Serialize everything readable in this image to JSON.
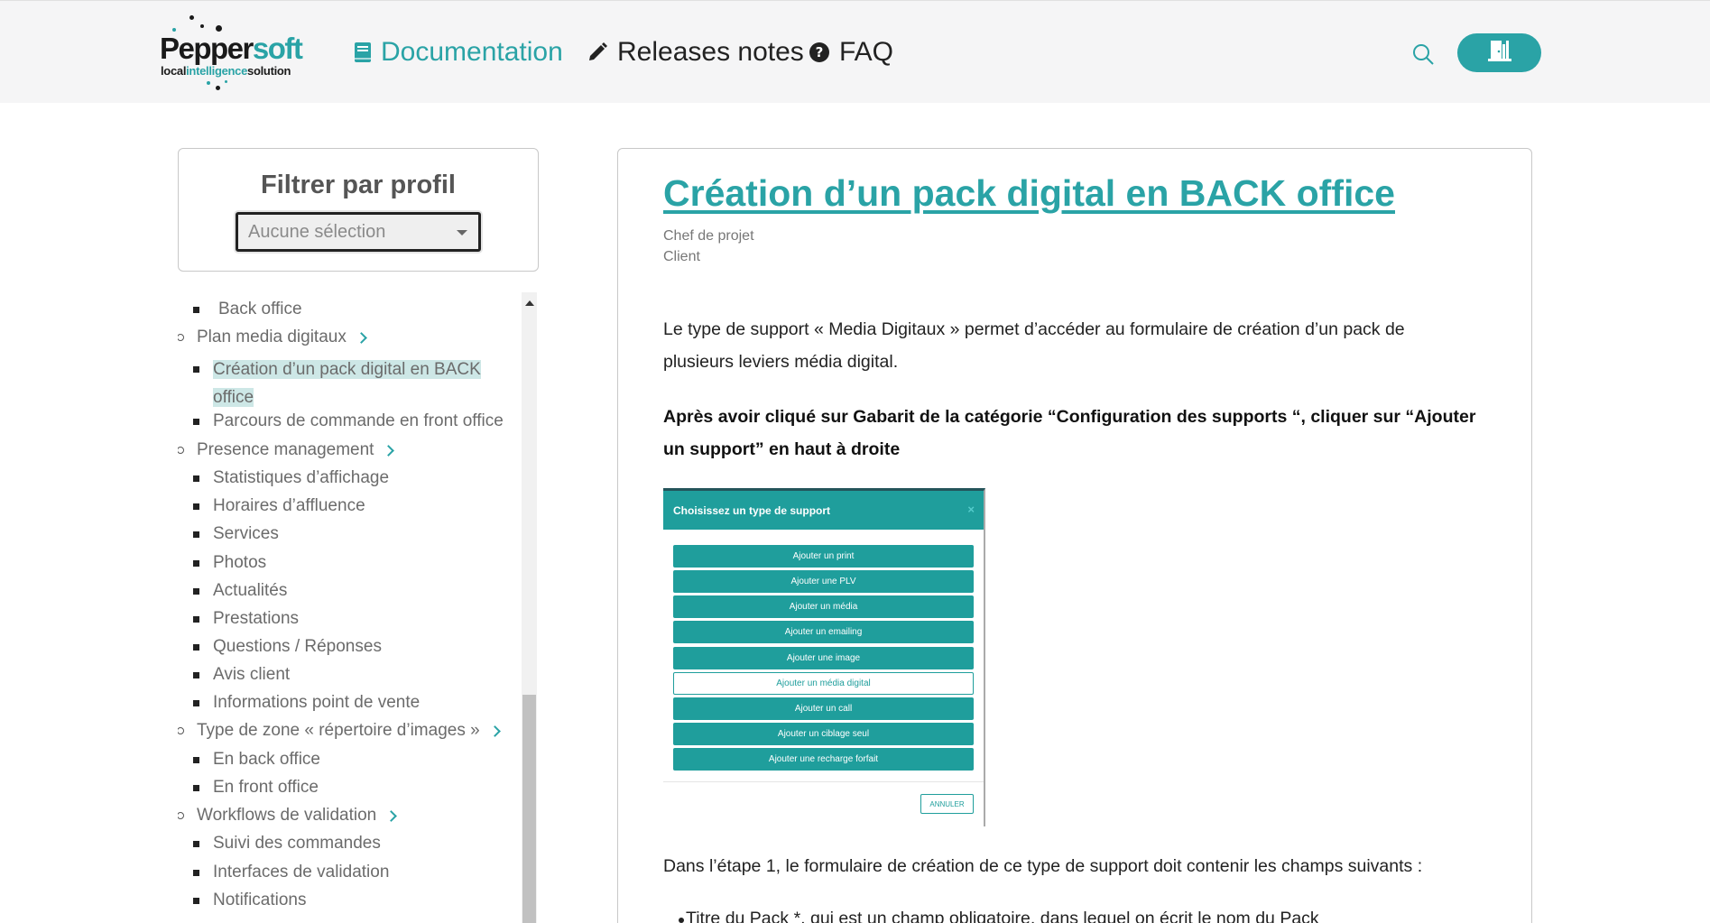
{
  "header": {
    "logo": {
      "main_a": "Pepper",
      "main_b": "soft",
      "sub_a": "local",
      "sub_b": "intelligence",
      "sub_c": "solution"
    },
    "nav": [
      {
        "label": "Documentation",
        "icon": "book-icon",
        "active": true
      },
      {
        "label": "Releases notes",
        "icon": "pencil-icon"
      },
      {
        "label": "FAQ",
        "icon": "question-circle-icon"
      }
    ],
    "search_icon": "search-icon",
    "login_icon": "door-icon"
  },
  "filter": {
    "title": "Filtrer par profil",
    "selected": "Aucune sélection"
  },
  "tree": [
    {
      "label": "Back office",
      "level": 2
    },
    {
      "label": "Plan media digitaux",
      "level": 1,
      "expandable": true
    },
    {
      "label": "Création d’un pack digital en BACK",
      "label_cont": "office",
      "level": 2,
      "active": true
    },
    {
      "label": "Parcours de commande en front office",
      "level": 2
    },
    {
      "label": "Presence management",
      "level": 1,
      "expandable": true
    },
    {
      "label": "Statistiques d’affichage",
      "level": 2
    },
    {
      "label": "Horaires d’affluence",
      "level": 2
    },
    {
      "label": "Services",
      "level": 2
    },
    {
      "label": "Photos",
      "level": 2
    },
    {
      "label": "Actualités",
      "level": 2
    },
    {
      "label": "Prestations",
      "level": 2
    },
    {
      "label": "Questions / Réponses",
      "level": 2
    },
    {
      "label": "Avis client",
      "level": 2
    },
    {
      "label": "Informations point de vente",
      "level": 2
    },
    {
      "label": "Type de zone « répertoire d’images »",
      "level": 1,
      "expandable": true
    },
    {
      "label": "En back office",
      "level": 2
    },
    {
      "label": "En front office",
      "level": 2
    },
    {
      "label": "Workflows de validation",
      "level": 1,
      "expandable": true
    },
    {
      "label": "Suivi des commandes",
      "level": 2
    },
    {
      "label": "Interfaces de validation",
      "level": 2
    },
    {
      "label": "Notifications",
      "level": 2
    }
  ],
  "article": {
    "title": "Création d’un pack digital en BACK office",
    "roles": [
      "Chef de projet",
      "Client"
    ],
    "para1_line1": "Le type de support « Media Digitaux » permet d’accéder au formulaire de création d’un pack de",
    "para1_line2": "plusieurs leviers média digital.",
    "para2_line1": "Après avoir cliqué sur Gabarit de la catégorie “Configuration des supports “, cliquer sur “Ajouter",
    "para2_line2": "un support” en haut à droite",
    "modal": {
      "title": "Choisissez un type de support",
      "close": "×",
      "options": [
        {
          "label": "Ajouter un print"
        },
        {
          "label": "Ajouter une PLV"
        },
        {
          "label": "Ajouter un média"
        },
        {
          "label": "Ajouter un emailing"
        },
        {
          "label": "Ajouter une image"
        },
        {
          "label": "Ajouter un média digital",
          "selected": true
        },
        {
          "label": "Ajouter un call"
        },
        {
          "label": "Ajouter un ciblage seul"
        },
        {
          "label": "Ajouter une recharge forfait"
        }
      ],
      "cancel": "ANNULER"
    },
    "para3": "Dans l’étape 1, le formulaire de création de ce type de support doit contenir les champs suivants :",
    "list_item": "Titre du Pack *, qui est un champ obligatoire, dans lequel on écrit le nom du Pack"
  },
  "colors": {
    "accent": "#2aa3a6",
    "header_bg": "#f5f5f6",
    "highlight": "#cde7e6"
  }
}
